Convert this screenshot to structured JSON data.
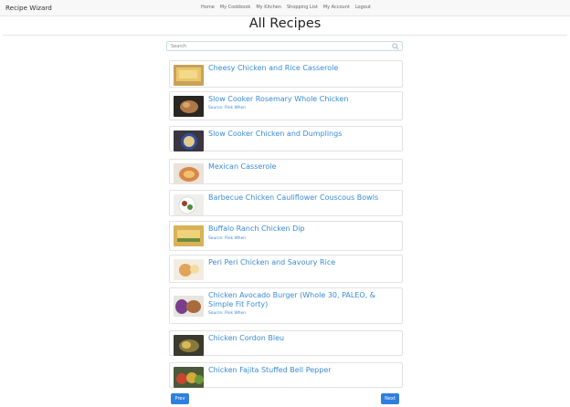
{
  "app": {
    "brand": "Recipe Wizard"
  },
  "nav": {
    "links": [
      "Home",
      "My Cookbook",
      "My Kitchen",
      "Shopping List",
      "My Account",
      "Logout"
    ]
  },
  "page": {
    "title": "All Recipes"
  },
  "search": {
    "placeholder": "Search"
  },
  "recipes": [
    {
      "title": "Cheesy Chicken and Rice Casserole",
      "source": ""
    },
    {
      "title": "Slow Cooker Rosemary Whole Chicken",
      "source": "Source: Pink When"
    },
    {
      "title": "Slow Cooker Chicken and Dumplings",
      "source": ""
    },
    {
      "title": "Mexican Casserole",
      "source": ""
    },
    {
      "title": "Barbecue Chicken Cauliflower Couscous Bowls",
      "source": ""
    },
    {
      "title": "Buffalo Ranch Chicken Dip",
      "source": "Source: Pink When"
    },
    {
      "title": "Peri Peri Chicken and Savoury Rice",
      "source": ""
    },
    {
      "title": "Chicken Avocado Burger (Whole 30, PALEO, & Simple Fit Forty)",
      "source": "Source: Pink When"
    },
    {
      "title": "Chicken Cordon Bleu",
      "source": ""
    },
    {
      "title": "Chicken Fajita Stuffed Bell Pepper",
      "source": ""
    }
  ],
  "pagination": {
    "prev": "Prev",
    "next": "Next"
  },
  "colors": {
    "link": "#3a8bd6",
    "button": "#2f7fe0",
    "navbar": "#f8f8f8"
  }
}
